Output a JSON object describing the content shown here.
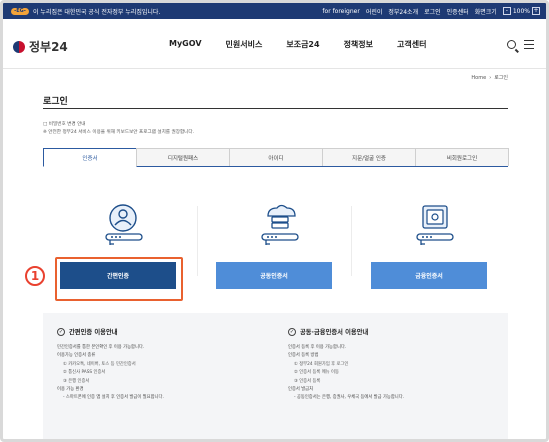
{
  "topbar": {
    "badge": "-EG-",
    "notice": "이 누리집은 대한민국 공식 전자정부 누리집입니다.",
    "links": [
      "for foreigner",
      "어린이",
      "정부24소개",
      "로그인",
      "인증센터",
      "화면크기"
    ],
    "zoom_minus": "-",
    "zoom_value": "100%",
    "zoom_plus": "+"
  },
  "header": {
    "logo_text": "정부24",
    "nav": [
      "MyGOV",
      "민원서비스",
      "보조금24",
      "정책정보",
      "고객센터"
    ]
  },
  "breadcrumb": {
    "home": "Home",
    "sep": "›",
    "current": "로그인"
  },
  "page": {
    "title": "로그인",
    "notes": [
      "□ 비밀번호 변경 안내",
      "※ 안전한 정부24 서비스 이용을 위해 키보드보안 프로그램 설치를 권장합니다."
    ]
  },
  "tabs": [
    "인증서",
    "디지털원패스",
    "아이디",
    "지문/얼굴 인증",
    "비회원로그인"
  ],
  "cards": [
    {
      "button": "간편인증"
    },
    {
      "button": "공동인증서"
    },
    {
      "button": "금융인증서"
    }
  ],
  "callout_number": "1",
  "info": {
    "left": {
      "title": "간편인증 이용안내",
      "items": [
        "민간인증서를 통한 본인확인 후 이용 가능합니다.",
        "이용가능 인증서 종류",
        "① 카카오톡, 네이버, 토스 등 민간인증서",
        "② 통신사 PASS 인증서",
        "③ 은행 인증서",
        "이용 가능 환경",
        "- 스마트폰에 인증 앱 설치 후 인증서 발급이 필요합니다."
      ]
    },
    "right": {
      "title": "공동·금융인증서 이용안내",
      "items": [
        "인증서 등록 후 이용 가능합니다.",
        "인증서 등록 방법",
        "① 정부24 회원가입 후 로그인",
        "② 인증서 등록 메뉴 이동",
        "③ 인증서 등록",
        "인증서 발급처",
        "- 공동인증서는 은행, 증권사, 우체국 등에서 발급 가능합니다."
      ]
    }
  },
  "colors": {
    "navy": "#1e3a74",
    "primary_btn": "#1d4e8a",
    "secondary_btn": "#4f8dd8",
    "highlight": "#e9612f"
  }
}
